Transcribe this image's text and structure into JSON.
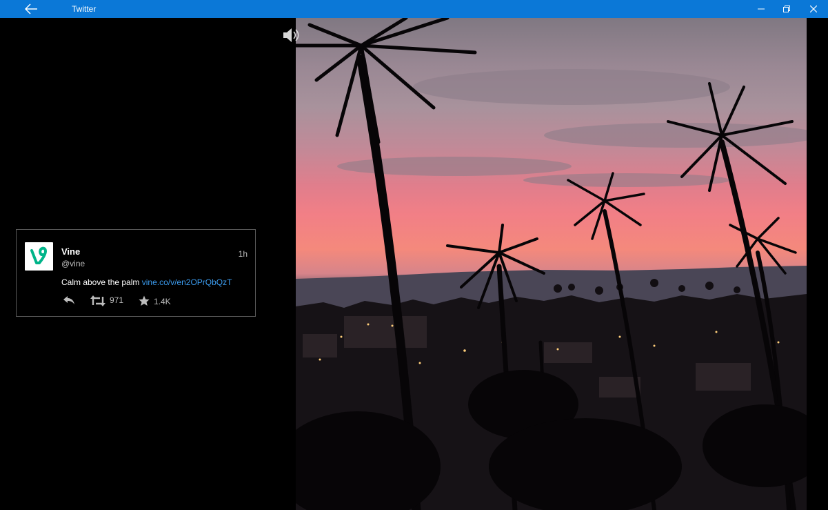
{
  "window": {
    "title": "Twitter"
  },
  "tweet": {
    "author_name": "Vine",
    "author_handle": "@vine",
    "time": "1h",
    "text": "Calm above the palm",
    "link": "vine.co/v/en2OPrQbQzT",
    "retweet_count": "971",
    "favorite_count": "1.4K"
  },
  "colors": {
    "titlebar": "#0b78d7",
    "link": "#3b9bee",
    "vine_brand": "#00b489"
  },
  "icons": [
    "back-arrow-icon",
    "minimize-icon",
    "restore-icon",
    "close-icon",
    "vine-logo-icon",
    "reply-icon",
    "retweet-icon",
    "star-icon",
    "volume-icon"
  ]
}
